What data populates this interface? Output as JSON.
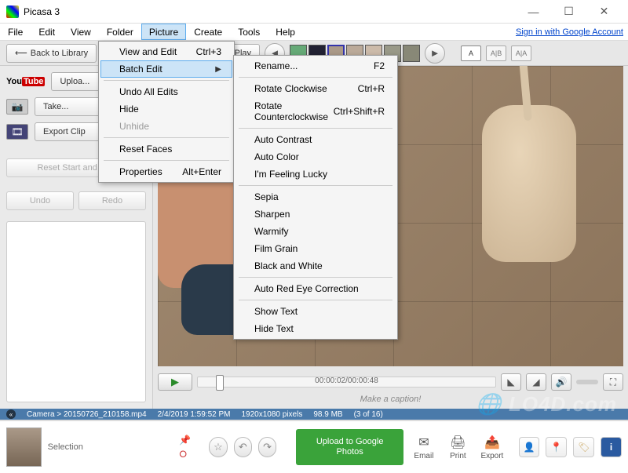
{
  "title": "Picasa 3",
  "signin_link": "Sign in with Google Account",
  "menubar": [
    "File",
    "Edit",
    "View",
    "Folder",
    "Picture",
    "Create",
    "Tools",
    "Help"
  ],
  "menubar_open_index": 4,
  "toolstrip": {
    "back_label": "Back to Library",
    "play_label": "Play"
  },
  "viewmodes": [
    "A",
    "A|B",
    "A|A"
  ],
  "leftpanel": {
    "upload_label": "Uploa...",
    "take_label": "Take...",
    "export_label": "Export Clip",
    "reset_label": "Reset Start and End",
    "undo_label": "Undo",
    "redo_label": "Redo"
  },
  "dropdown": {
    "items": [
      {
        "label": "View and Edit",
        "shortcut": "Ctrl+3"
      },
      {
        "label": "Batch Edit",
        "submenu": true,
        "highlight": true
      },
      {
        "sep": true
      },
      {
        "label": "Undo All Edits"
      },
      {
        "label": "Hide"
      },
      {
        "label": "Unhide",
        "disabled": true
      },
      {
        "sep": true
      },
      {
        "label": "Reset Faces"
      },
      {
        "sep": true
      },
      {
        "label": "Properties",
        "shortcut": "Alt+Enter"
      }
    ]
  },
  "submenu": {
    "items": [
      {
        "label": "Rename...",
        "shortcut": "F2"
      },
      {
        "sep": true
      },
      {
        "label": "Rotate Clockwise",
        "shortcut": "Ctrl+R"
      },
      {
        "label": "Rotate Counterclockwise",
        "shortcut": "Ctrl+Shift+R"
      },
      {
        "sep": true
      },
      {
        "label": "Auto Contrast"
      },
      {
        "label": "Auto Color"
      },
      {
        "label": "I'm Feeling Lucky"
      },
      {
        "sep": true
      },
      {
        "label": "Sepia"
      },
      {
        "label": "Sharpen"
      },
      {
        "label": "Warmify"
      },
      {
        "label": "Film Grain"
      },
      {
        "label": "Black and White"
      },
      {
        "sep": true
      },
      {
        "label": "Auto Red Eye Correction"
      },
      {
        "sep": true
      },
      {
        "label": "Show Text"
      },
      {
        "label": "Hide Text"
      }
    ]
  },
  "playbar": {
    "timecode": "00:00:02/00:00:48"
  },
  "caption_placeholder": "Make a caption!",
  "status": {
    "path": "Camera > 20150726_210158.mp4",
    "datetime": "2/4/2019 1:59:52 PM",
    "dims": "1920x1080 pixels",
    "size": "98.9 MB",
    "index": "(3 of 16)"
  },
  "tray": {
    "selection_label": "Selection",
    "upload_label": "Upload to Google Photos",
    "tools": [
      "Email",
      "Print",
      "Export"
    ]
  },
  "watermark": "LO4D.com"
}
